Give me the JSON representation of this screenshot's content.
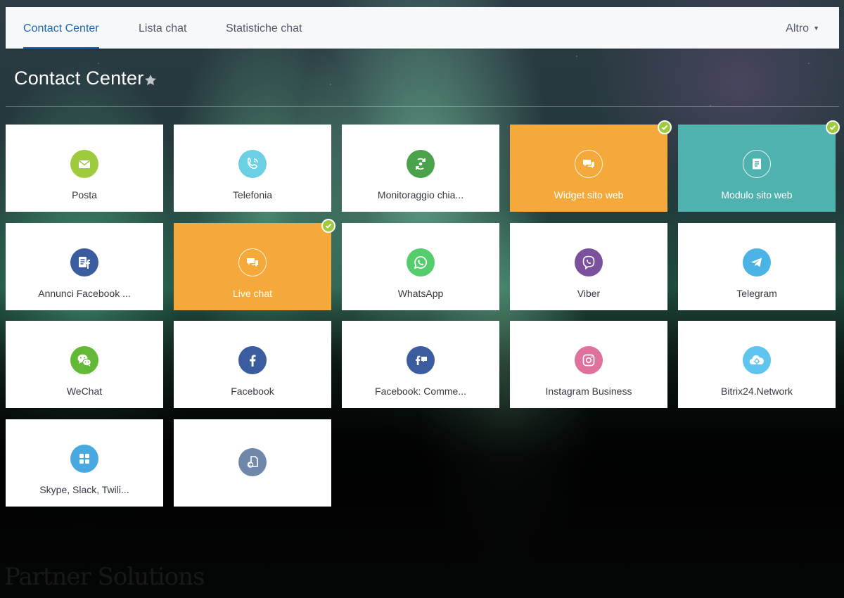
{
  "topbar": {
    "tabs": [
      {
        "label": "Contact Center",
        "active": true
      },
      {
        "label": "Lista chat",
        "active": false
      },
      {
        "label": "Statistiche chat",
        "active": false
      }
    ],
    "more_label": "Altro"
  },
  "page": {
    "title": "Contact Center"
  },
  "tiles": [
    {
      "label": "Posta",
      "icon": "mail-icon",
      "color": "#9dcb3c",
      "style": "white",
      "connected": false
    },
    {
      "label": "Telefonia",
      "icon": "phone-icon",
      "color": "#6bd0e3",
      "style": "white",
      "connected": false
    },
    {
      "label": "Monitoraggio chia...",
      "icon": "call-tracking-icon",
      "color": "#4aa34a",
      "style": "white",
      "connected": false
    },
    {
      "label": "Widget sito web",
      "icon": "chat-bubbles-icon",
      "color": "#f5a93a",
      "style": "orange",
      "connected": true
    },
    {
      "label": "Modulo sito web",
      "icon": "form-icon",
      "color": "#4fb2ae",
      "style": "teal",
      "connected": true
    },
    {
      "label": "Annunci Facebook ...",
      "icon": "facebook-leads-icon",
      "color": "#3b5c9e",
      "style": "white",
      "connected": false
    },
    {
      "label": "Live chat",
      "icon": "chat-bubbles-icon",
      "color": "#f5a93a",
      "style": "orange",
      "connected": true
    },
    {
      "label": "WhatsApp",
      "icon": "whatsapp-icon",
      "color": "#55cd6c",
      "style": "white",
      "connected": false
    },
    {
      "label": "Viber",
      "icon": "viber-icon",
      "color": "#7b519d",
      "style": "white",
      "connected": false
    },
    {
      "label": "Telegram",
      "icon": "telegram-icon",
      "color": "#4bb3e6",
      "style": "white",
      "connected": false
    },
    {
      "label": "WeChat",
      "icon": "wechat-icon",
      "color": "#62b936",
      "style": "white",
      "connected": false
    },
    {
      "label": "Facebook",
      "icon": "facebook-icon",
      "color": "#3b5c9e",
      "style": "white",
      "connected": false
    },
    {
      "label": "Facebook: Comme...",
      "icon": "facebook-comments-icon",
      "color": "#3b5c9e",
      "style": "white",
      "connected": false
    },
    {
      "label": "Instagram Business",
      "icon": "instagram-icon",
      "color": "#e0709c",
      "style": "white",
      "connected": false
    },
    {
      "label": "Bitrix24.Network",
      "icon": "cloud-network-icon",
      "color": "#5fc4ee",
      "style": "white",
      "connected": false
    },
    {
      "label": "Skype, Slack, Twili...",
      "icon": "apps-grid-icon",
      "color": "#48a8e0",
      "style": "white",
      "connected": false
    },
    {
      "label": "",
      "icon": "import-icon",
      "color": "#6f88a9",
      "style": "white",
      "connected": false
    }
  ],
  "watermark": "Partner Solutions"
}
